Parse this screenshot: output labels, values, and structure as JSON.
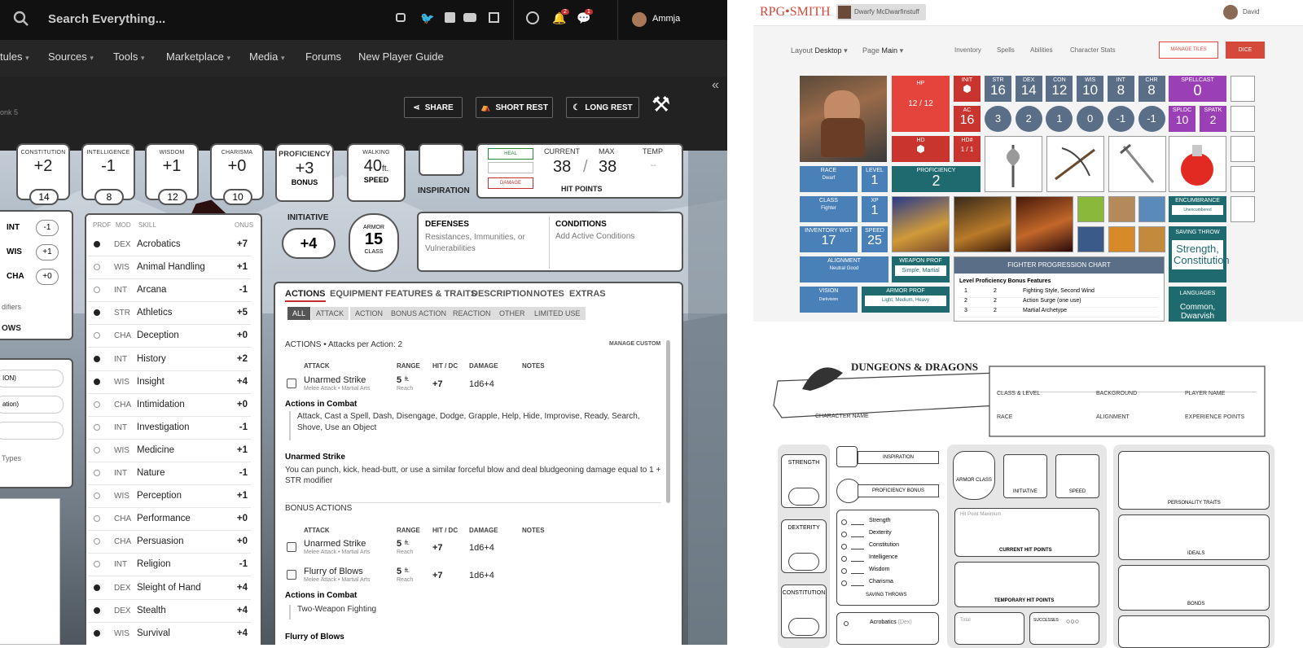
{
  "ddb": {
    "search_placeholder": "Search Everything...",
    "notif_count": "2",
    "chat_count": "1",
    "username": "Ammja",
    "nav": [
      "tules",
      "Sources",
      "Tools",
      "Marketplace",
      "Media",
      "Forums",
      "New Player Guide"
    ],
    "subtitle": "onk 5",
    "buttons": {
      "share": "SHARE",
      "short_rest": "SHORT REST",
      "long_rest": "LONG REST"
    },
    "abilities": [
      {
        "name": "CONSTITUTION",
        "mod": "+2",
        "score": "14"
      },
      {
        "name": "INTELLIGENCE",
        "mod": "-1",
        "score": "8"
      },
      {
        "name": "WISDOM",
        "mod": "+1",
        "score": "12"
      },
      {
        "name": "CHARISMA",
        "mod": "+0",
        "score": "10"
      }
    ],
    "proficiency": {
      "label": "PROFICIENCY",
      "value": "+3",
      "sub": "BONUS"
    },
    "walking": {
      "label": "WALKING",
      "value": "40",
      "unit": "ft.",
      "sub": "SPEED"
    },
    "inspiration": "INSPIRATION",
    "hp": {
      "heal": "HEAL",
      "damage": "DAMAGE",
      "current_label": "CURRENT",
      "max_label": "MAX",
      "temp_label": "TEMP",
      "current": "38",
      "sep": "/",
      "max": "38",
      "temp": "--",
      "footer": "HIT POINTS"
    },
    "saves": [
      {
        "ab": "INT",
        "v": "-1"
      },
      {
        "ab": "WIS",
        "v": "+1"
      },
      {
        "ab": "CHA",
        "v": "+0"
      }
    ],
    "left_frag": {
      "modifiers": "difiers",
      "saving_label": "OWS",
      "prof1": "ION)",
      "prof2": "ation)",
      "types": "Types"
    },
    "skills_head": {
      "prof": "PROF",
      "mod": "MOD",
      "skill": "SKILL",
      "bonus": "ONUS"
    },
    "skills": [
      {
        "mod": "DEX",
        "name": "Acrobatics",
        "bonus": "+7",
        "p": true
      },
      {
        "mod": "WIS",
        "name": "Animal Handling",
        "bonus": "+1",
        "p": false
      },
      {
        "mod": "INT",
        "name": "Arcana",
        "bonus": "-1",
        "p": false
      },
      {
        "mod": "STR",
        "name": "Athletics",
        "bonus": "+5",
        "p": true
      },
      {
        "mod": "CHA",
        "name": "Deception",
        "bonus": "+0",
        "p": false
      },
      {
        "mod": "INT",
        "name": "History",
        "bonus": "+2",
        "p": true
      },
      {
        "mod": "WIS",
        "name": "Insight",
        "bonus": "+4",
        "p": true
      },
      {
        "mod": "CHA",
        "name": "Intimidation",
        "bonus": "+0",
        "p": false
      },
      {
        "mod": "INT",
        "name": "Investigation",
        "bonus": "-1",
        "p": false
      },
      {
        "mod": "WIS",
        "name": "Medicine",
        "bonus": "+1",
        "p": false
      },
      {
        "mod": "INT",
        "name": "Nature",
        "bonus": "-1",
        "p": false
      },
      {
        "mod": "WIS",
        "name": "Perception",
        "bonus": "+1",
        "p": false
      },
      {
        "mod": "CHA",
        "name": "Performance",
        "bonus": "+0",
        "p": false
      },
      {
        "mod": "CHA",
        "name": "Persuasion",
        "bonus": "+0",
        "p": false
      },
      {
        "mod": "INT",
        "name": "Religion",
        "bonus": "-1",
        "p": false
      },
      {
        "mod": "DEX",
        "name": "Sleight of Hand",
        "bonus": "+4",
        "p": true
      },
      {
        "mod": "DEX",
        "name": "Stealth",
        "bonus": "+4",
        "p": true
      },
      {
        "mod": "WIS",
        "name": "Survival",
        "bonus": "+4",
        "p": true
      }
    ],
    "initiative": {
      "label": "INITIATIVE",
      "value": "+4"
    },
    "armor": {
      "label": "ARMOR",
      "value": "15",
      "sub": "CLASS"
    },
    "defenses": {
      "title": "DEFENSES",
      "text": "Resistances, Immunities, or Vulnerabilities"
    },
    "conditions": {
      "title": "CONDITIONS",
      "text": "Add Active Conditions"
    },
    "tabs": [
      "ACTIONS",
      "EQUIPMENT",
      "FEATURES & TRAITS",
      "DESCRIPTION",
      "NOTES",
      "EXTRAS"
    ],
    "filters": [
      "ALL",
      "ATTACK",
      "ACTION",
      "BONUS ACTION",
      "REACTION",
      "OTHER",
      "LIMITED USE"
    ],
    "actions_header": "ACTIONS • Attacks per Action: 2",
    "manage_custom": "MANAGE CUSTOM",
    "cols": {
      "attack": "ATTACK",
      "range": "RANGE",
      "hit": "HIT / DC",
      "damage": "DAMAGE",
      "notes": "NOTES"
    },
    "attack1": {
      "name": "Unarmed Strike",
      "sub": "Melee Attack • Martial Arts",
      "range": "5",
      "range_unit": "ft.",
      "reach": "Reach",
      "hit": "+7",
      "dmg": "1d6+4"
    },
    "in_combat": "Actions in Combat",
    "combat_text": "Attack, Cast a Spell, Dash, Disengage, Dodge, Grapple, Help, Hide, Improvise, Ready, Search, Shove, Use an Object",
    "unarmed_title": "Unarmed Strike",
    "unarmed_text": "You can punch, kick, head-butt, or use a similar forceful blow and deal bludgeoning damage equal to 1 + STR modifier",
    "bonus_actions": "BONUS ACTIONS",
    "attack2": {
      "name": "Unarmed Strike",
      "sub": "Melee Attack • Martial Arts",
      "range": "5",
      "range_unit": "ft.",
      "reach": "Reach",
      "hit": "+7",
      "dmg": "1d6+4"
    },
    "attack3": {
      "name": "Flurry of Blows",
      "sub": "Melee Attack • Martial Arts",
      "range": "5",
      "range_unit": "ft.",
      "reach": "Reach",
      "hit": "+7",
      "dmg": "1d6+4"
    },
    "in_combat2": "Actions in Combat",
    "twf": "Two-Weapon Fighting",
    "flurry_head": "Flurry of Blows"
  },
  "rpg": {
    "brand": "RPG•SMITH",
    "char_tab": "Dwarfy McDwarfinstuff",
    "user": "David",
    "layout_label": "Layout",
    "layout_val": "Desktop",
    "page_label": "Page",
    "page_val": "Main",
    "links": [
      "Inventory",
      "Spells",
      "Abilities",
      "Character Stats"
    ],
    "manage_tiles": "MANAGE TILES",
    "dice": "DICE",
    "hp": {
      "l": "HP",
      "v": "12 / 12"
    },
    "hd": {
      "l": "HD"
    },
    "hd2": {
      "l": "HD#",
      "v": "1 / 1"
    },
    "init": {
      "l": "INIT"
    },
    "ac": {
      "l": "AC",
      "v": "16"
    },
    "stats": [
      {
        "l": "STR",
        "v": "16",
        "m": "3"
      },
      {
        "l": "DEX",
        "v": "14",
        "m": "2"
      },
      {
        "l": "CON",
        "v": "12",
        "m": "1"
      },
      {
        "l": "WIS",
        "v": "10",
        "m": "0"
      },
      {
        "l": "INT",
        "v": "8",
        "m": "-1"
      },
      {
        "l": "CHR",
        "v": "8",
        "m": "-1"
      }
    ],
    "spellcast": {
      "l": "SPELLCAST",
      "v": "0"
    },
    "spldc": {
      "l": "SPLDC",
      "v": "10"
    },
    "spatk": {
      "l": "SPATK",
      "v": "2"
    },
    "race": {
      "l": "RACE",
      "v": "Dwarf"
    },
    "level": {
      "l": "LEVEL",
      "v": "1"
    },
    "prof": {
      "l": "PROFICIENCY",
      "v": "2"
    },
    "class": {
      "l": "CLASS",
      "v": "Fighter"
    },
    "xp": {
      "l": "XP",
      "v": "1"
    },
    "inv_wgt": {
      "l": "INVENTORY WGT",
      "v": "17"
    },
    "speed": {
      "l": "SPEED",
      "v": "25"
    },
    "encumbrance": {
      "l": "ENCUMBRANCE",
      "v": "Unencumbered"
    },
    "saving": {
      "l": "SAVING THROW",
      "v": "Strength, Constitution"
    },
    "alignment": {
      "l": "ALIGNMENT",
      "v": "Neutral Good"
    },
    "weapon_prof": {
      "l": "WEAPON PROF",
      "v": "Simple, Martial"
    },
    "vision": {
      "l": "VISION",
      "v": "Darkvision"
    },
    "armor_prof": {
      "l": "ARMOR PROF",
      "v": "Light, Medium, Heavy"
    },
    "languages": {
      "l": "LANGUAGES",
      "v": "Common, Dwarvish"
    },
    "chart": {
      "title": "FIGHTER PROGRESSION CHART",
      "headers": "Level Proficiency Bonus Features",
      "rows": [
        {
          "lv": "1",
          "pb": "2",
          "f": "Fighting Style, Second Wind"
        },
        {
          "lv": "2",
          "pb": "2",
          "f": "Action Surge (one use)"
        },
        {
          "lv": "3",
          "pb": "2",
          "f": "Martial Archetype"
        }
      ]
    }
  },
  "sheet": {
    "logo": "DUNGEONS & DRAGONS",
    "char_name": "CHARACTER NAME",
    "class_level": "CLASS & LEVEL",
    "background": "BACKGROUND",
    "player_name": "PLAYER NAME",
    "race": "RACE",
    "alignment": "ALIGNMENT",
    "xp": "EXPERIENCE POINTS",
    "strength": "STRENGTH",
    "dexterity": "DEXTERITY",
    "constitution": "CONSTITUTION",
    "inspiration": "INSPIRATION",
    "prof_bonus": "PROFICIENCY BONUS",
    "saves": [
      "Strength",
      "Dexterity",
      "Constitution",
      "Intelligence",
      "Wisdom",
      "Charisma"
    ],
    "saving_throws": "SAVING THROWS",
    "acrobatics": "Acrobatics",
    "acro_dex": "(Dex)",
    "armor_class": "ARMOR CLASS",
    "initiative": "INITIATIVE",
    "speed": "SPEED",
    "hp_max": "Hit Point Maximum",
    "current_hp": "CURRENT HIT POINTS",
    "temp_hp": "TEMPORARY HIT POINTS",
    "total": "Total",
    "successes": "SUCCESSES",
    "personality": "PERSONALITY TRAITS",
    "ideals": "IDEALS",
    "bonds": "BONDS"
  }
}
